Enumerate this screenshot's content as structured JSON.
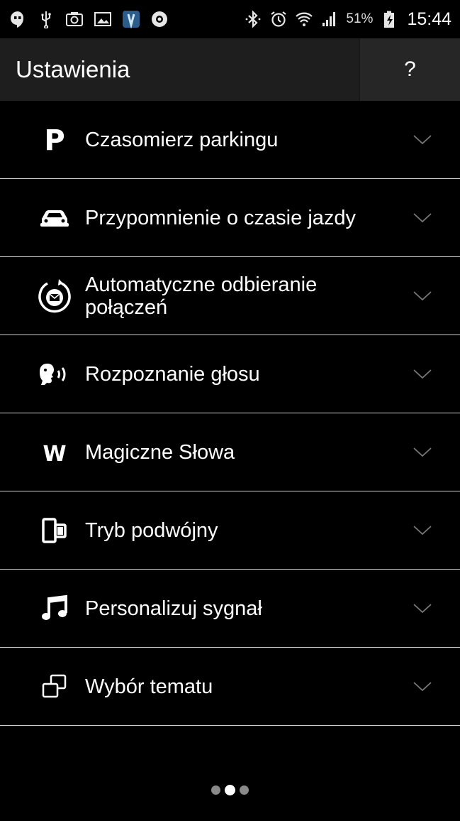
{
  "status_bar": {
    "left_icons": [
      "hangouts-icon",
      "usb-icon",
      "camera-icon",
      "gallery-icon",
      "app-icon",
      "opera-icon"
    ],
    "right_icons": [
      "bluetooth-icon",
      "alarm-icon",
      "wifi-icon",
      "signal-icon"
    ],
    "battery_percent": "51%",
    "time": "15:44"
  },
  "app_bar": {
    "title": "Ustawienia",
    "help_label": "?"
  },
  "settings": [
    {
      "icon": "parking-icon",
      "label": "Czasomierz parkingu"
    },
    {
      "icon": "car-icon",
      "label": "Przypomnienie o czasie jazdy"
    },
    {
      "icon": "auto-answer-icon",
      "label": "Automatyczne odbieranie połączeń"
    },
    {
      "icon": "voice-recognition-icon",
      "label": "Rozpoznanie głosu"
    },
    {
      "icon": "magic-words-icon",
      "label": "Magiczne Słowa"
    },
    {
      "icon": "dual-mode-icon",
      "label": "Tryb podwójny"
    },
    {
      "icon": "music-note-icon",
      "label": "Personalizuj sygnał"
    },
    {
      "icon": "theme-icon",
      "label": "Wybór tematu"
    }
  ],
  "pager": {
    "count": 3,
    "active_index": 1
  }
}
